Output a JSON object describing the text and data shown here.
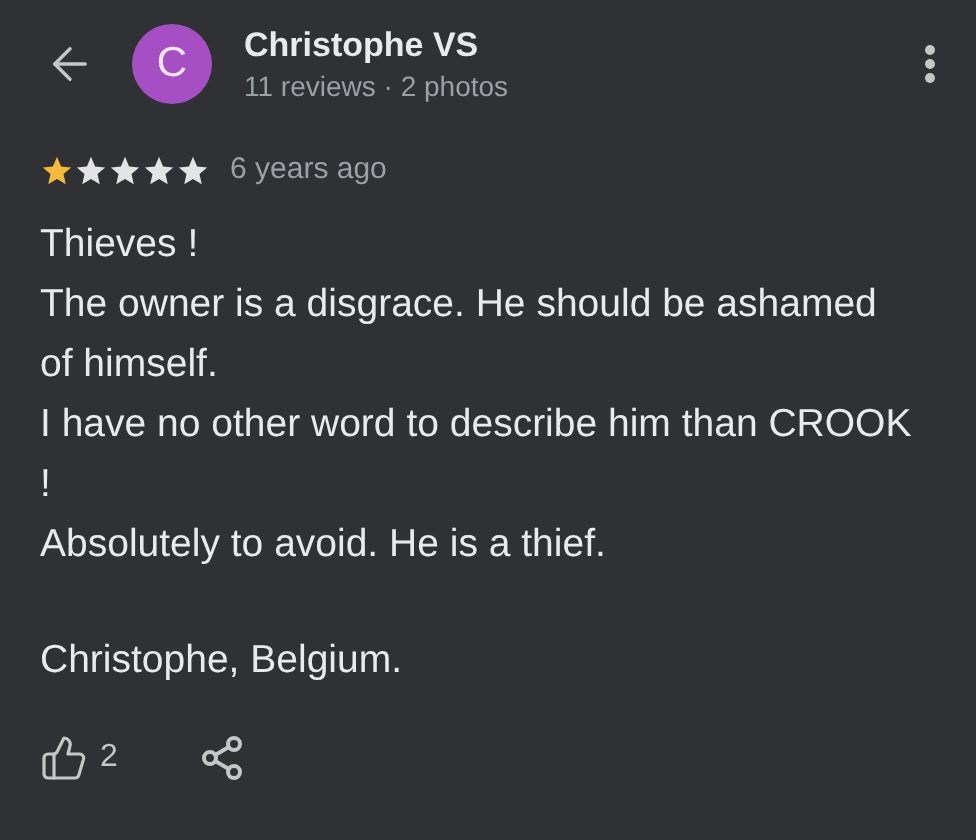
{
  "reviewer": {
    "initial": "C",
    "color": "#a64fc4",
    "name": "Christophe VS",
    "meta": "11 reviews · 2 photos"
  },
  "review": {
    "stars": 1,
    "time": "6 years ago",
    "paragraphs": [
      "Thieves !",
      "The owner is a disgrace. He should be ashamed of himself.",
      "I have no other word to describe him than CROOK !",
      "Absolutely to avoid. He is a thief."
    ],
    "signature": "Christophe, Belgium."
  },
  "actions": {
    "likes": "2"
  }
}
